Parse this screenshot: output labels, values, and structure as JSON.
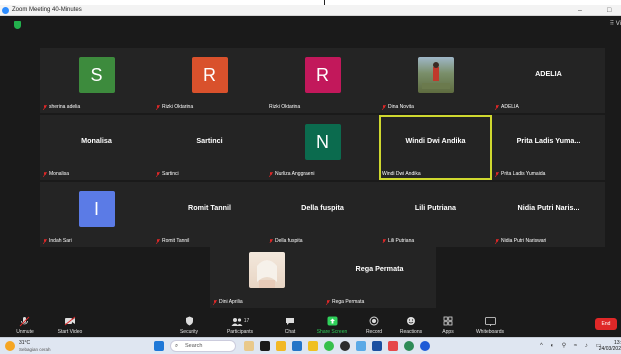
{
  "window": {
    "title": "Zoom Meeting 40-Minutes",
    "minimize": "–",
    "maximize": "□",
    "view_label": "Vi"
  },
  "tiles": [
    {
      "name": "sherina adelia",
      "type": "avatar",
      "initial": "S",
      "color": "#3d8b3d",
      "muted": true
    },
    {
      "name": "Rizki Oktarina",
      "type": "avatar",
      "initial": "R",
      "color": "#d9512c",
      "muted": true
    },
    {
      "name": "Rizki Oktarina",
      "type": "avatar",
      "initial": "R",
      "color": "#c2185b",
      "muted": false
    },
    {
      "name": "Dina Novita",
      "type": "photo",
      "muted": true
    },
    {
      "name": "ADELIA",
      "type": "text",
      "display": "ADELIA",
      "muted": true
    },
    {
      "name": "Monalisa",
      "type": "text",
      "display": "Monalisa",
      "muted": true
    },
    {
      "name": "Sartinci",
      "type": "text",
      "display": "Sartinci",
      "muted": true
    },
    {
      "name": "Nurliza Anggraeni",
      "type": "avatar",
      "initial": "N",
      "color": "#0b6b4e",
      "muted": true
    },
    {
      "name": "Windi Dwi Andika",
      "type": "text",
      "display": "Windi Dwi Andika",
      "muted": false,
      "active": true
    },
    {
      "name": "Prita Ladis Yumaida",
      "type": "text",
      "display": "Prita Ladis Yuma...",
      "muted": true
    },
    {
      "name": "Indah Sari",
      "type": "avatar",
      "initial": "I",
      "color": "#5b7be6",
      "muted": true
    },
    {
      "name": "Romit Tannil",
      "type": "text",
      "display": "Romit Tannil",
      "muted": true
    },
    {
      "name": "Della fuspita",
      "type": "text",
      "display": "Della fuspita",
      "muted": true
    },
    {
      "name": "Lili Putriana",
      "type": "text",
      "display": "Lili Putriana",
      "muted": true
    },
    {
      "name": "Nidia Putri Nariswari",
      "type": "text",
      "display": "Nidia Putri Naris...",
      "muted": true
    },
    {
      "name": "Dini Aprilia",
      "type": "photo2",
      "muted": true
    },
    {
      "name": "Rega Permata",
      "type": "text",
      "display": "Rega Permata",
      "muted": true
    }
  ],
  "toolbar": {
    "unmute": "Unmute",
    "start_video": "Start Video",
    "security": "Security",
    "participants": "Participants",
    "participants_count": "17",
    "chat": "Chat",
    "share_screen": "Share Screen",
    "record": "Record",
    "reactions": "Reactions",
    "apps": "Apps",
    "whiteboards": "Whiteboards",
    "end": "End"
  },
  "taskbar": {
    "temp": "31°C",
    "weather": "Sebagian cerah",
    "search": "Search",
    "time": "13:",
    "date": "24/03/202"
  },
  "colors": {
    "accent_green": "#2fd05a",
    "end_red": "#e02828",
    "highlight": "#cfd82f"
  }
}
